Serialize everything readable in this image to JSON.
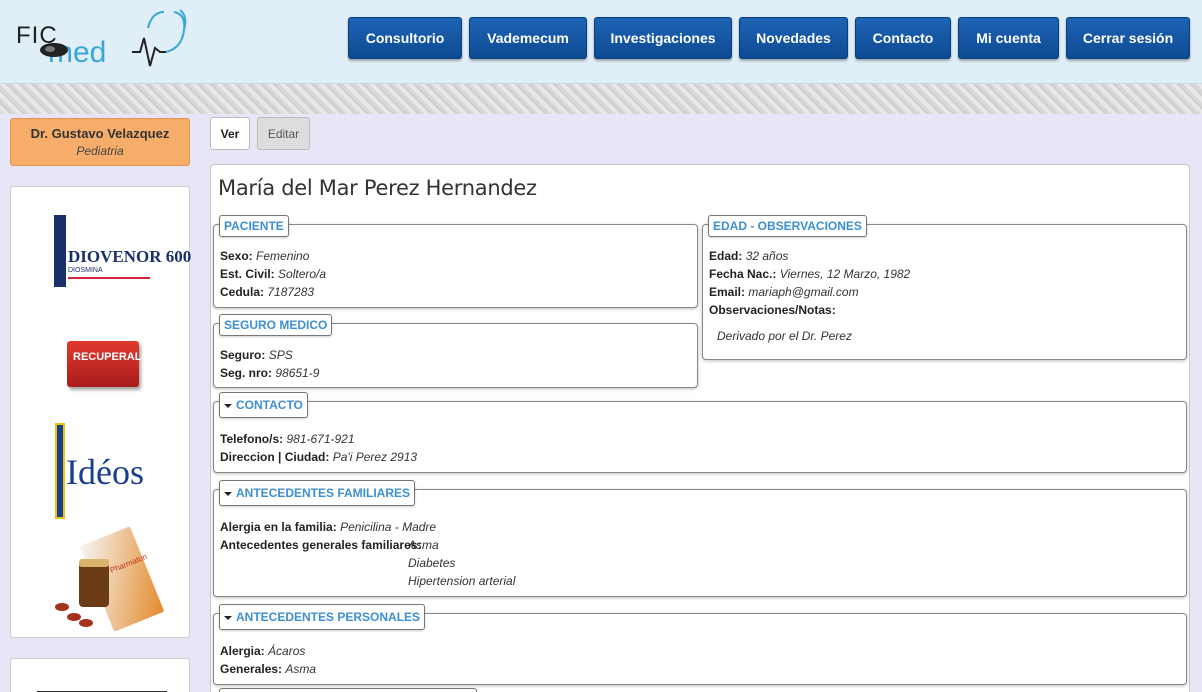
{
  "header": {
    "logo_fic": "FIC",
    "logo_med": "med",
    "nav": [
      {
        "label": "Consultorio"
      },
      {
        "label": "Vademecum"
      },
      {
        "label": "Investigaciones"
      },
      {
        "label": "Novedades"
      },
      {
        "label": "Contacto"
      },
      {
        "label": "Mi cuenta"
      },
      {
        "label": "Cerrar sesión"
      }
    ]
  },
  "doctor": {
    "name": "Dr. Gustavo Velazquez",
    "specialty": "Pediatria"
  },
  "ads": {
    "diovenor": "DIOVENOR 600",
    "diovenor_sub": "DIOSMINA",
    "recuperal": "RECUPERAL",
    "ideos": "Idéos",
    "pharmaton": "Pharmaton"
  },
  "tabs": {
    "ver": "Ver",
    "editar": "Editar"
  },
  "patient": {
    "name": "María del Mar Perez Hernandez",
    "paciente": {
      "title": "PACIENTE",
      "sexo_label": "Sexo:",
      "sexo": "Femenino",
      "civil_label": "Est. Civil:",
      "civil": "Soltero/a",
      "cedula_label": "Cedula:",
      "cedula": "7187283"
    },
    "edad": {
      "title": "EDAD - OBSERVACIONES",
      "edad_label": "Edad:",
      "edad": "32 años",
      "nac_label": "Fecha Nac.:",
      "nac": "Viernes, 12 Marzo, 1982",
      "email_label": "Email:",
      "email": "mariaph@gmail.com",
      "obs_label": "Observaciones/Notas:",
      "obs": "Derivado por el Dr. Perez"
    },
    "seguro": {
      "title": "SEGURO MEDICO",
      "seguro_label": "Seguro:",
      "seguro": "SPS",
      "nro_label": "Seg. nro:",
      "nro": "98651-9"
    },
    "contacto": {
      "title": "CONTACTO",
      "tel_label": "Telefono/s:",
      "tel": "981-671-921",
      "dir_label": "Direccion | Ciudad:",
      "dir": "Pa'i Perez 2913"
    },
    "familiares": {
      "title": "ANTECEDENTES FAMILIARES",
      "alergia_label": "Alergia en la familia:",
      "alergia": "Penicilina - Madre",
      "generales_label": "Antecedentes generales familiares:",
      "generales": [
        "Asma",
        "Diabetes",
        "Hipertension arterial"
      ]
    },
    "personales": {
      "title": "ANTECEDENTES PERSONALES",
      "alergia_label": "Alergia:",
      "alergia": "Ácaros",
      "generales_label": "Generales:",
      "generales": "Asma"
    }
  },
  "colors": {
    "nav_blue": "#0d4a93",
    "accent": "#3d8fd1",
    "doctor_bg": "#f7ad6a"
  }
}
